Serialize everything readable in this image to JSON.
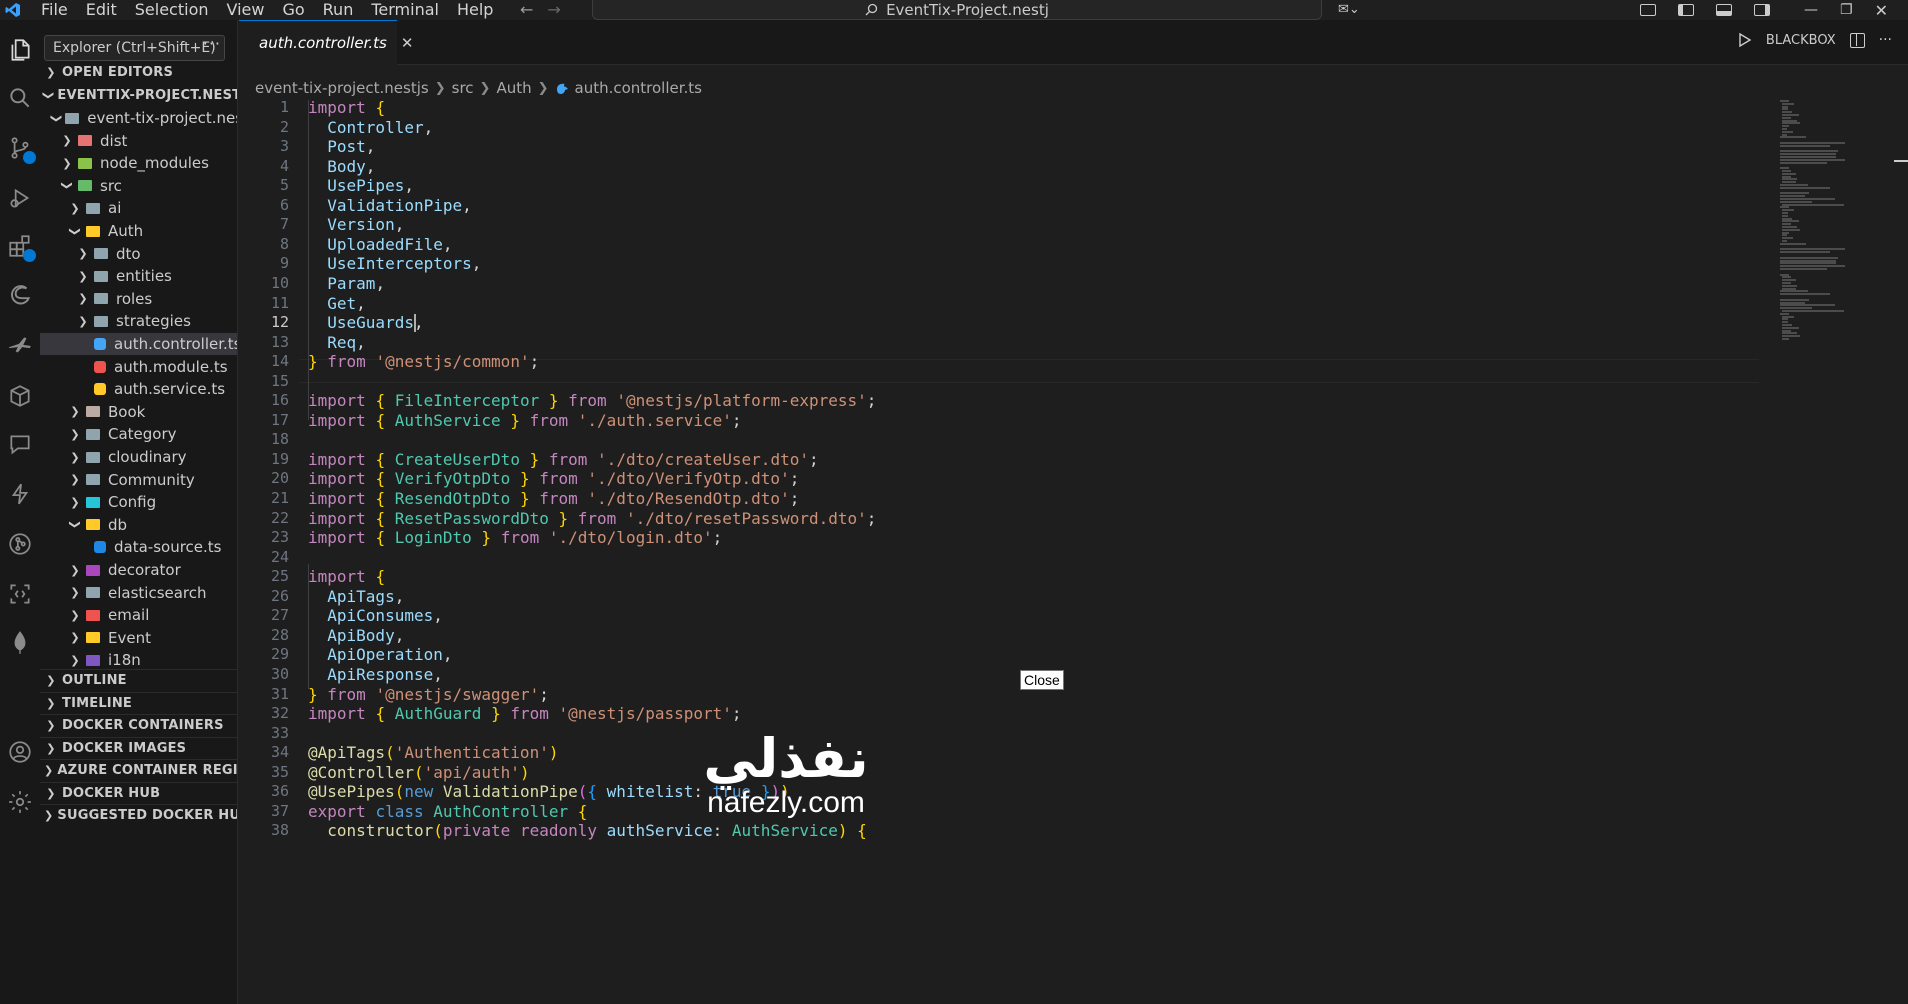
{
  "menu": [
    "File",
    "Edit",
    "Selection",
    "View",
    "Go",
    "Run",
    "Terminal",
    "Help"
  ],
  "search": {
    "label": "EventTix-Project.nestj"
  },
  "sidebar": {
    "tooltip": "Explorer (Ctrl+Shift+E)",
    "sections": {
      "open_editors": "OPEN EDITORS",
      "project": "EVENTTIX-PROJECT.NESTJ",
      "outline": "OUTLINE",
      "timeline": "TIMELINE",
      "docker_containers": "DOCKER CONTAINERS",
      "docker_images": "DOCKER IMAGES",
      "azure_registry": "AZURE CONTAINER REGISTRY",
      "docker_hub": "DOCKER HUB",
      "suggested": "SUGGESTED DOCKER HUB IMA..."
    },
    "tree": [
      {
        "label": "event-tix-project.nestjs",
        "depth": 1,
        "open": true,
        "color": "#90a4ae"
      },
      {
        "label": "dist",
        "depth": 2,
        "open": false,
        "color": "#e57373"
      },
      {
        "label": "node_modules",
        "depth": 2,
        "open": false,
        "color": "#8bc34a"
      },
      {
        "label": "src",
        "depth": 2,
        "open": true,
        "color": "#66bb6a"
      },
      {
        "label": "ai",
        "depth": 3,
        "open": false,
        "color": "#90a4ae"
      },
      {
        "label": "Auth",
        "depth": 3,
        "open": true,
        "color": "#ffca28"
      },
      {
        "label": "dto",
        "depth": 4,
        "open": false,
        "color": "#90a4ae"
      },
      {
        "label": "entities",
        "depth": 4,
        "open": false,
        "color": "#90a4ae"
      },
      {
        "label": "roles",
        "depth": 4,
        "open": false,
        "color": "#90a4ae"
      },
      {
        "label": "strategies",
        "depth": 4,
        "open": false,
        "color": "#90a4ae"
      },
      {
        "label": "auth.controller.ts",
        "depth": 4,
        "file": true,
        "color": "#42a5f5",
        "selected": true
      },
      {
        "label": "auth.module.ts",
        "depth": 4,
        "file": true,
        "color": "#ef5350"
      },
      {
        "label": "auth.service.ts",
        "depth": 4,
        "file": true,
        "color": "#ffca28"
      },
      {
        "label": "Book",
        "depth": 3,
        "open": false,
        "color": "#bcaaa4"
      },
      {
        "label": "Category",
        "depth": 3,
        "open": false,
        "color": "#90a4ae"
      },
      {
        "label": "cloudinary",
        "depth": 3,
        "open": false,
        "color": "#90a4ae"
      },
      {
        "label": "Community",
        "depth": 3,
        "open": false,
        "color": "#90a4ae"
      },
      {
        "label": "Config",
        "depth": 3,
        "open": false,
        "color": "#26c6da"
      },
      {
        "label": "db",
        "depth": 3,
        "open": true,
        "color": "#ffca28"
      },
      {
        "label": "data-source.ts",
        "depth": 4,
        "file": true,
        "color": "#1e88e5"
      },
      {
        "label": "decorator",
        "depth": 3,
        "open": false,
        "color": "#ab47bc"
      },
      {
        "label": "elasticsearch",
        "depth": 3,
        "open": false,
        "color": "#90a4ae"
      },
      {
        "label": "email",
        "depth": 3,
        "open": false,
        "color": "#ef5350"
      },
      {
        "label": "Event",
        "depth": 3,
        "open": false,
        "color": "#ffca28"
      },
      {
        "label": "i18n",
        "depth": 3,
        "open": false,
        "color": "#7e57c2"
      }
    ]
  },
  "tab": {
    "label": "auth.controller.ts"
  },
  "tab_actions": {
    "blackbox": "BLACKBOX"
  },
  "breadcrumb": [
    "event-tix-project.nestjs",
    "src",
    "Auth",
    "auth.controller.ts"
  ],
  "editor": {
    "active_line": 12,
    "lines": [
      "import {",
      "  Controller,",
      "  Post,",
      "  Body,",
      "  UsePipes,",
      "  ValidationPipe,",
      "  Version,",
      "  UploadedFile,",
      "  UseInterceptors,",
      "  Param,",
      "  Get,",
      "  UseGuards,",
      "  Req,",
      "} from '@nestjs/common';",
      "",
      "import { FileInterceptor } from '@nestjs/platform-express';",
      "import { AuthService } from './auth.service';",
      "",
      "import { CreateUserDto } from './dto/createUser.dto';",
      "import { VerifyOtpDto } from './dto/VerifyOtp.dto';",
      "import { ResendOtpDto } from './dto/ResendOtp.dto';",
      "import { ResetPasswordDto } from './dto/resetPassword.dto';",
      "import { LoginDto } from './dto/login.dto';",
      "",
      "import {",
      "  ApiTags,",
      "  ApiConsumes,",
      "  ApiBody,",
      "  ApiOperation,",
      "  ApiResponse,",
      "} from '@nestjs/swagger';",
      "import { AuthGuard } from '@nestjs/passport';",
      "",
      "@ApiTags('Authentication')",
      "@Controller('api/auth')",
      "@UsePipes(new ValidationPipe({ whitelist: true }))",
      "export class AuthController {",
      "  constructor(private readonly authService: AuthService) {"
    ]
  },
  "close_tooltip": "Close",
  "watermark": {
    "arabic": "نفذلي",
    "latin": "nafezly.com"
  }
}
